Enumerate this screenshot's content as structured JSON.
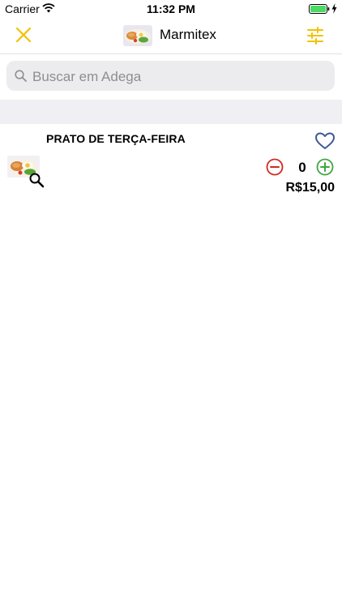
{
  "status_bar": {
    "carrier": "Carrier",
    "time": "11:32 PM"
  },
  "nav": {
    "title": "Marmitex",
    "accent_color": "#f2c200"
  },
  "search": {
    "placeholder": "Buscar em Adega",
    "value": ""
  },
  "product": {
    "name": "PRATO DE TERÇA-FEIRA",
    "quantity": "0",
    "price": "R$15,00",
    "heart_color": "#3d5a98",
    "minus_color": "#d0291f",
    "plus_color": "#3fa542"
  }
}
